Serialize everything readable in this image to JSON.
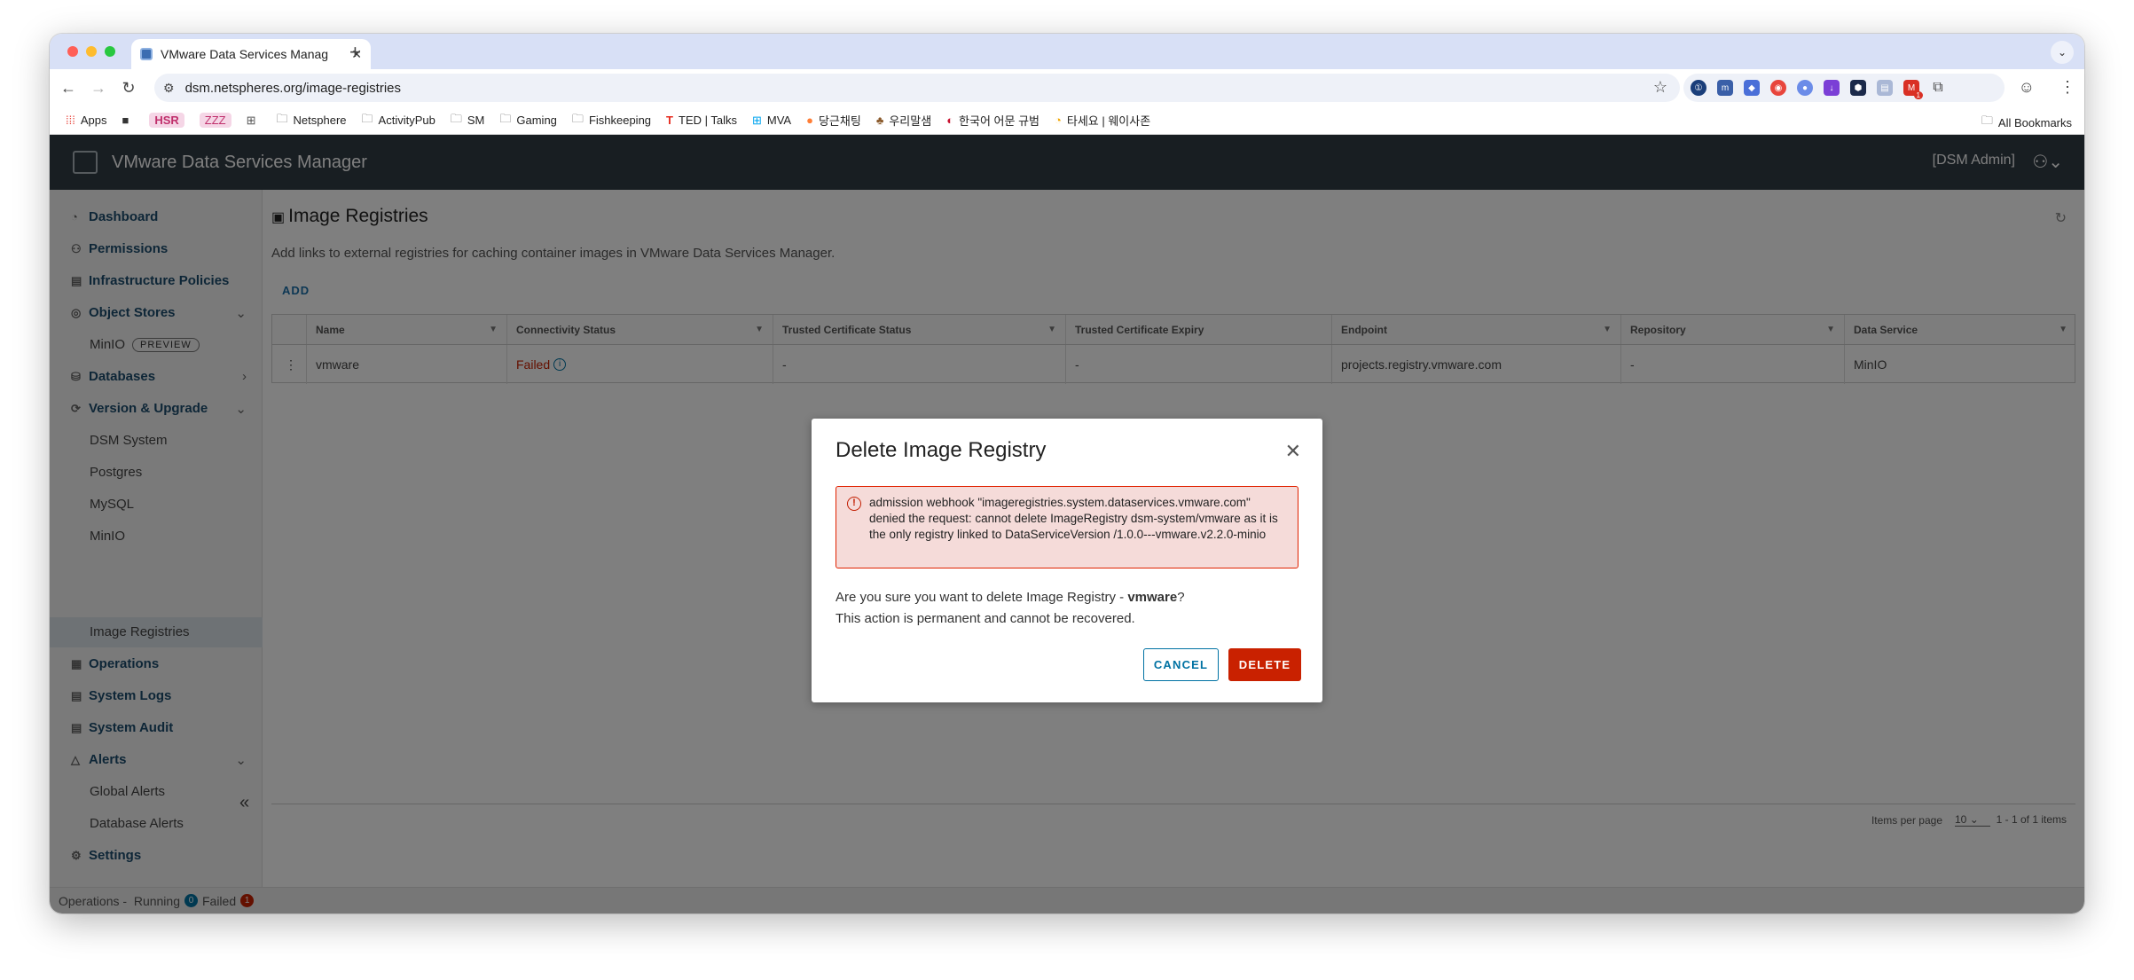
{
  "browser": {
    "tab_title": "VMware Data Services Manag",
    "url": "dsm.netspheres.org/image-registries",
    "bookmarks": [
      "Apps",
      "HSR",
      "ZZZ",
      "Netsphere",
      "ActivityPub",
      "SM",
      "Gaming",
      "Fishkeeping",
      "TED | Talks",
      "MVA",
      "당근채팅",
      "우리말샘",
      "한국어 어문 규범",
      "타세요 | 웨이사존"
    ],
    "all_bookmarks": "All Bookmarks",
    "ext_badge": "1"
  },
  "app": {
    "title": "VMware Data Services Manager",
    "user": "[DSM Admin]"
  },
  "sidebar": {
    "dashboard": "Dashboard",
    "permissions": "Permissions",
    "infrastructure_policies": "Infrastructure Policies",
    "object_stores": "Object Stores",
    "minio": "MinIO",
    "preview": "PREVIEW",
    "databases": "Databases",
    "version_upgrade": "Version & Upgrade",
    "dsm_system": "DSM System",
    "postgres": "Postgres",
    "mysql": "MySQL",
    "minio2": "MinIO",
    "image_registries": "Image Registries",
    "operations": "Operations",
    "system_logs": "System Logs",
    "system_audit": "System Audit",
    "alerts": "Alerts",
    "global_alerts": "Global Alerts",
    "database_alerts": "Database Alerts",
    "settings": "Settings"
  },
  "statusbar": {
    "operations": "Operations",
    "sep": "-",
    "running": "Running",
    "running_count": "0",
    "failed": "Failed",
    "failed_count": "1"
  },
  "page": {
    "title": "Image Registries",
    "description": "Add links to external registries for caching container images in VMware Data Services Manager.",
    "add": "ADD"
  },
  "table": {
    "columns": [
      "Name",
      "Connectivity Status",
      "Trusted Certificate Status",
      "Trusted Certificate Expiry",
      "Endpoint",
      "Repository",
      "Data Service"
    ],
    "rows": [
      {
        "name": "vmware",
        "connectivity": "Failed",
        "cert_status": "-",
        "cert_expiry": "-",
        "endpoint": "projects.registry.vmware.com",
        "repository": "-",
        "data_service": "MinIO"
      }
    ],
    "items_per_page_label": "Items per page",
    "items_per_page": "10",
    "range": "1 - 1 of 1 items"
  },
  "modal": {
    "title": "Delete Image Registry",
    "alert_text": "admission webhook \"imageregistries.system.dataservices.vmware.com\" denied the request: cannot delete ImageRegistry dsm-system/vmware as it is the only registry linked to DataServiceVersion /1.0.0---vmware.v2.2.0-minio",
    "question_prefix": "Are you sure you want to delete Image Registry - ",
    "question_name": "vmware",
    "question_suffix": "?",
    "permanent": "This action is permanent and cannot be recovered.",
    "cancel": "CANCEL",
    "delete": "DELETE"
  }
}
